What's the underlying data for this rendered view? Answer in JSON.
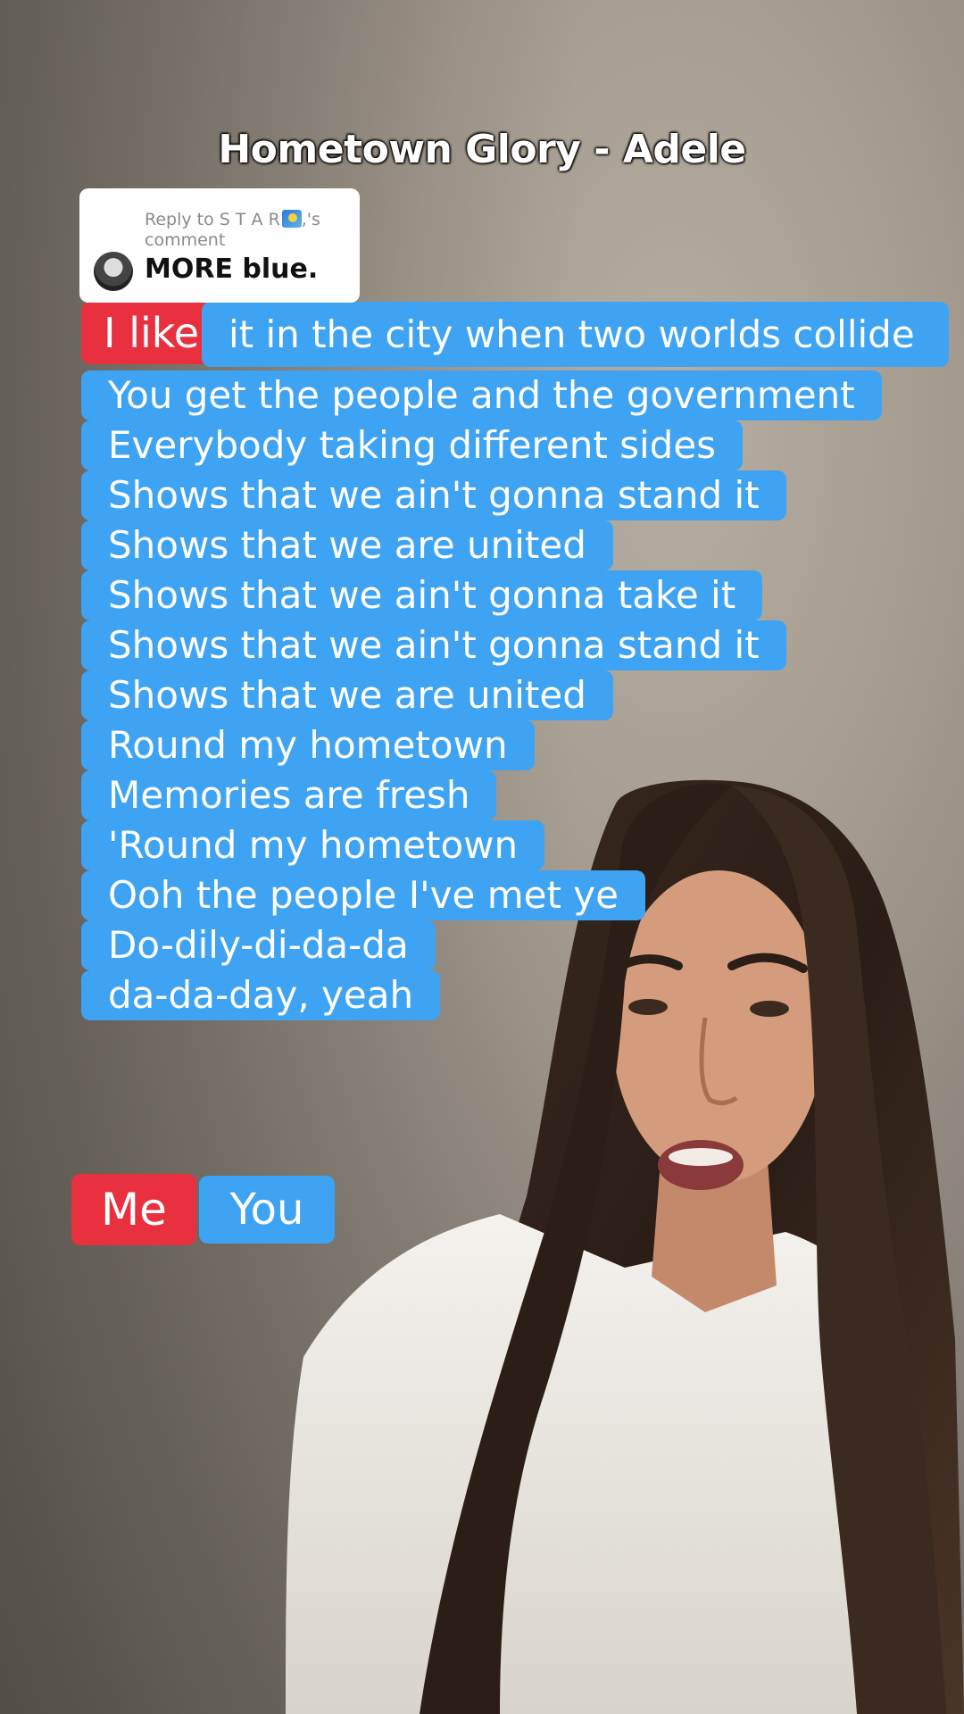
{
  "video": {
    "title": "Hometown Glory - Adele"
  },
  "reply": {
    "prefix": "Reply to ",
    "username": "S T A R",
    "suffix": ",'s",
    "comment_word": "comment",
    "body": "MORE blue.",
    "emoji_icon": "star-landscape-emoji"
  },
  "lyrics": {
    "first_red": "I like",
    "first_blue": "it in the city when two worlds collide",
    "lines": [
      "You get the people and the government",
      "Everybody taking different sides",
      "Shows that we ain't gonna stand it",
      "Shows that we are united",
      "Shows that we ain't gonna take it",
      "Shows that we ain't gonna stand it",
      "Shows that we are united",
      "Round my hometown",
      "Memories are fresh",
      "'Round my hometown",
      "Ooh the people I've met ye",
      "Do-dily-di-da-da",
      "da-da-day, yeah"
    ]
  },
  "legend": {
    "me": "Me",
    "you": "You"
  },
  "colors": {
    "red": "#e8303f",
    "blue": "#3ea3f2"
  }
}
